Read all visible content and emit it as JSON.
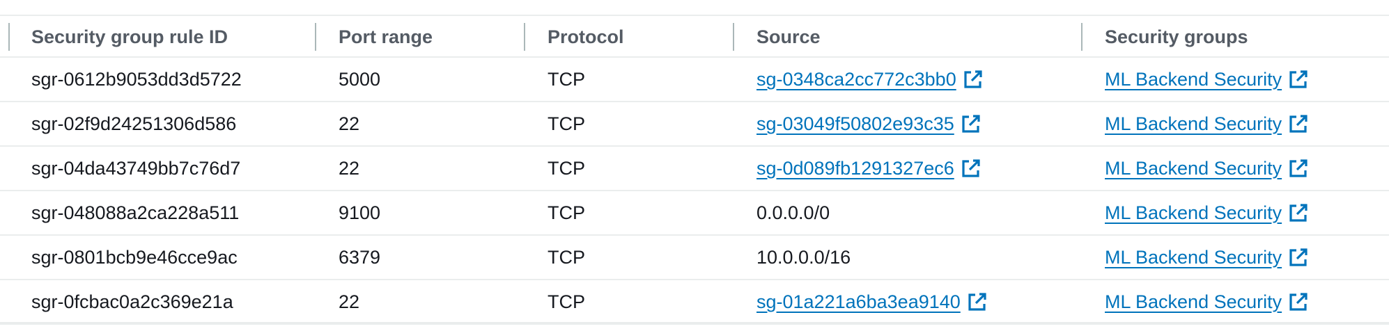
{
  "table": {
    "columns": [
      "Security group rule ID",
      "Port range",
      "Protocol",
      "Source",
      "Security groups"
    ],
    "rows": [
      {
        "rule_id": "sgr-0612b9053dd3d5722",
        "port_range": "5000",
        "protocol": "TCP",
        "source": "sg-0348ca2cc772c3bb0",
        "security_group": "ML Backend Security"
      },
      {
        "rule_id": "sgr-02f9d24251306d586",
        "port_range": "22",
        "protocol": "TCP",
        "source": "sg-03049f50802e93c35",
        "security_group": "ML Backend Security"
      },
      {
        "rule_id": "sgr-04da43749bb7c76d7",
        "port_range": "22",
        "protocol": "TCP",
        "source": "sg-0d089fb1291327ec6",
        "security_group": "ML Backend Security"
      },
      {
        "rule_id": "sgr-048088a2ca228a511",
        "port_range": "9100",
        "protocol": "TCP",
        "source": "0.0.0.0/0",
        "security_group": "ML Backend Security"
      },
      {
        "rule_id": "sgr-0801bcb9e46cce9ac",
        "port_range": "6379",
        "protocol": "TCP",
        "source": "10.0.0.0/16",
        "security_group": "ML Backend Security"
      },
      {
        "rule_id": "sgr-0fcbac0a2c369e21a",
        "port_range": "22",
        "protocol": "TCP",
        "source": "sg-01a221a6ba3ea9140",
        "security_group": "ML Backend Security"
      }
    ]
  },
  "icons": {
    "external_link": "external-link-icon"
  },
  "colors": {
    "link": "#0073bb",
    "text": "#16191f",
    "header_text": "#545b64",
    "border": "#eaeded",
    "divider": "#aab7b8"
  }
}
